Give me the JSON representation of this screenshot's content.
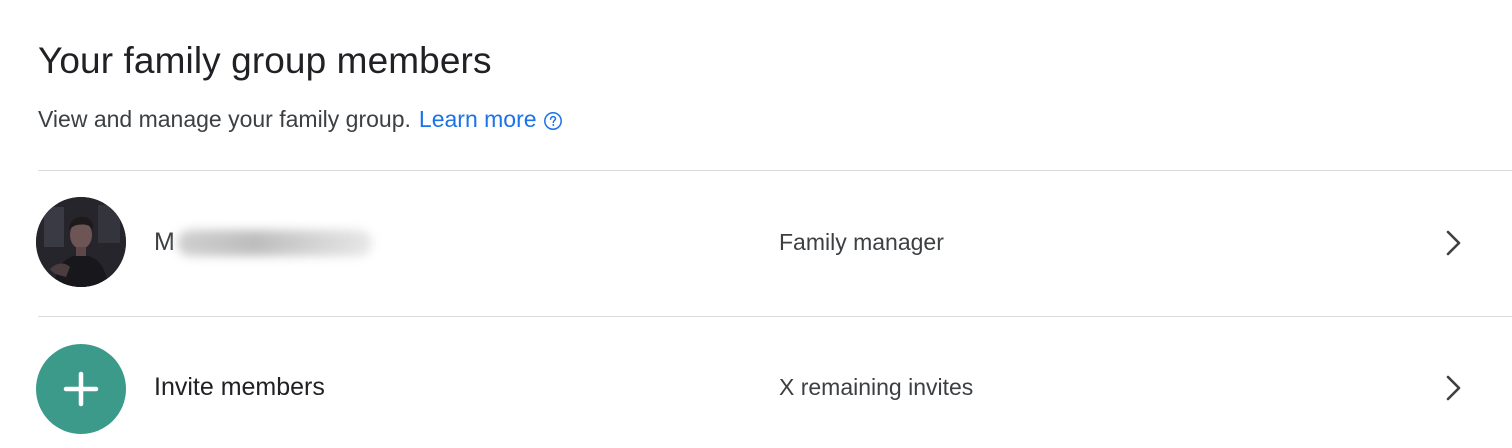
{
  "header": {
    "title": "Your family group members",
    "description": "View and manage your family group.",
    "learn_more_label": "Learn more"
  },
  "members": [
    {
      "name_visible": "M",
      "role": "Family manager",
      "avatar_icon": "profile-photo"
    }
  ],
  "invite": {
    "label": "Invite members",
    "remaining": "X remaining invites",
    "icon": "plus-icon"
  },
  "colors": {
    "link": "#1a73e8",
    "invite_circle": "#3c9a8a",
    "divider": "#dadce0",
    "text_primary": "#202124",
    "text_secondary": "#3c4043"
  }
}
